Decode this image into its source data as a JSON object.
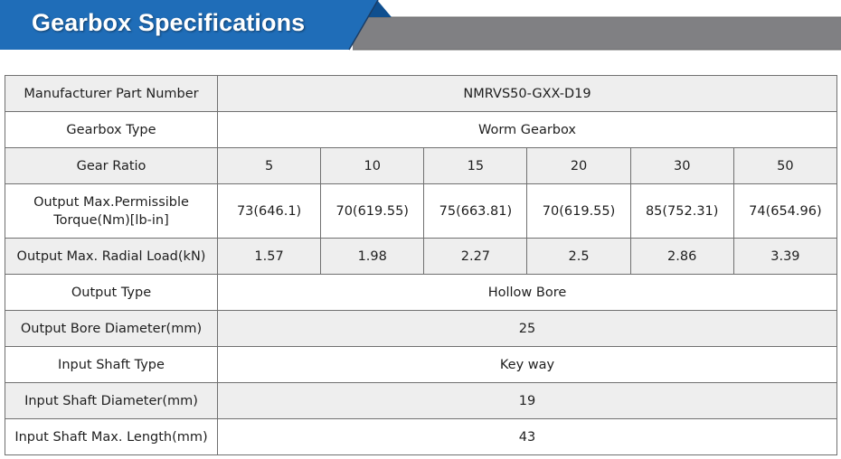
{
  "header": {
    "title": "Gearbox Specifications",
    "colors": {
      "title_bar": "#1f6db8",
      "title_bar_dark": "#0f4f8f",
      "gray_band": "#808080"
    }
  },
  "specs": {
    "part_number": {
      "label": "Manufacturer Part Number",
      "value": "NMRVS50-GXX-D19"
    },
    "gearbox_type": {
      "label": "Gearbox Type",
      "value": "Worm Gearbox"
    },
    "gear_ratio": {
      "label": "Gear Ratio",
      "values": [
        "5",
        "10",
        "15",
        "20",
        "30",
        "50"
      ]
    },
    "torque": {
      "label": "Output Max.Permissible Torque(Nm)[lb-in]",
      "values": [
        "73(646.1)",
        "70(619.55)",
        "75(663.81)",
        "70(619.55)",
        "85(752.31)",
        "74(654.96)"
      ]
    },
    "radial_load": {
      "label": "Output Max. Radial Load(kN)",
      "values": [
        "1.57",
        "1.98",
        "2.27",
        "2.5",
        "2.86",
        "3.39"
      ]
    },
    "output_type": {
      "label": "Output Type",
      "value": "Hollow Bore"
    },
    "output_bore": {
      "label": "Output Bore Diameter(mm)",
      "value": "25"
    },
    "input_shaft_type": {
      "label": "Input Shaft Type",
      "value": "Key way"
    },
    "input_shaft_diameter": {
      "label": "Input Shaft Diameter(mm)",
      "value": "19"
    },
    "input_shaft_length": {
      "label": "Input Shaft Max. Length(mm)",
      "value": "43"
    }
  }
}
